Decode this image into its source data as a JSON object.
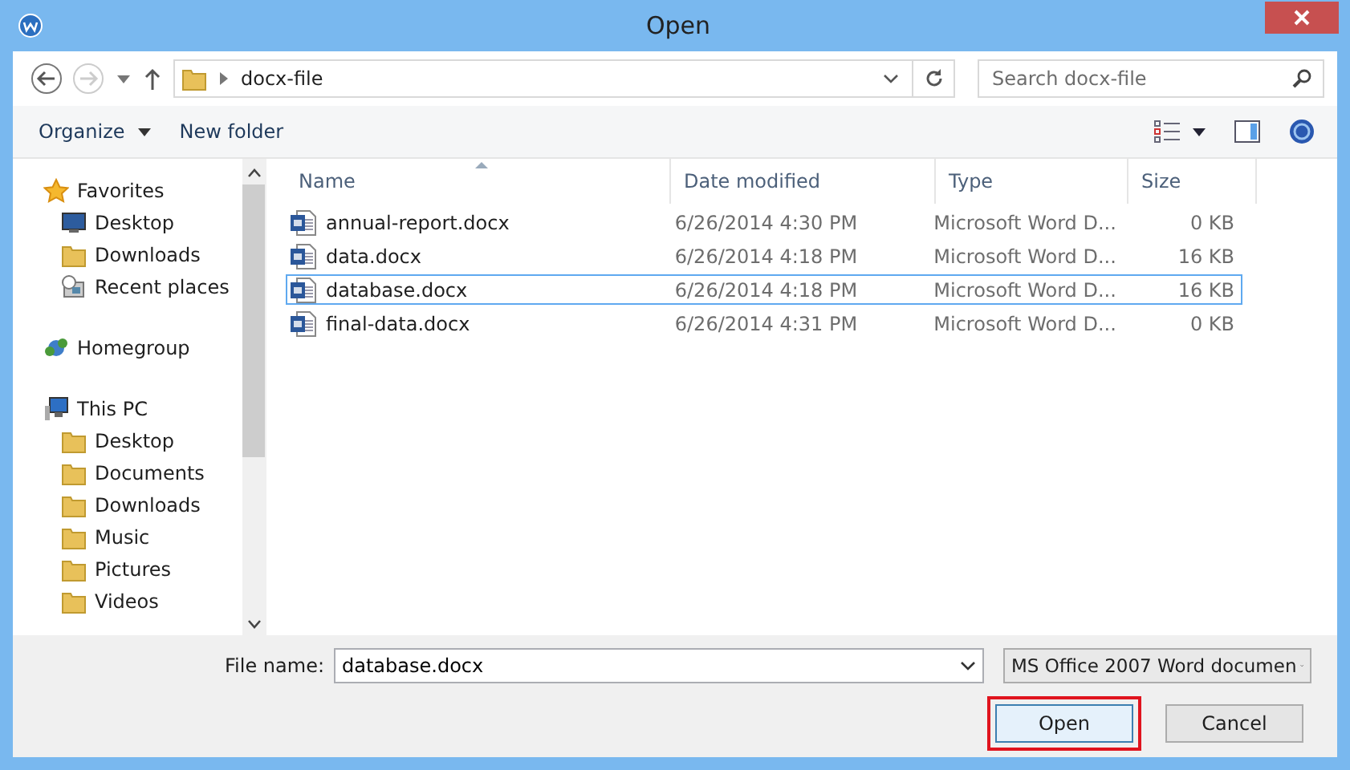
{
  "window": {
    "title": "Open"
  },
  "address": {
    "path": "docx-file"
  },
  "search": {
    "placeholder": "Search docx-file"
  },
  "toolbar": {
    "organize": "Organize",
    "new_folder": "New folder"
  },
  "sidebar": {
    "groups": [
      {
        "label": "Favorites",
        "kind": "star",
        "children": [
          {
            "label": "Desktop",
            "kind": "monitor"
          },
          {
            "label": "Downloads",
            "kind": "folder"
          },
          {
            "label": "Recent places",
            "kind": "recent"
          }
        ]
      },
      {
        "label": "Homegroup",
        "kind": "homegroup"
      },
      {
        "label": "This PC",
        "kind": "pc",
        "children": [
          {
            "label": "Desktop",
            "kind": "folder"
          },
          {
            "label": "Documents",
            "kind": "folder"
          },
          {
            "label": "Downloads",
            "kind": "folder"
          },
          {
            "label": "Music",
            "kind": "folder"
          },
          {
            "label": "Pictures",
            "kind": "folder"
          },
          {
            "label": "Videos",
            "kind": "folder"
          }
        ]
      }
    ]
  },
  "table": {
    "columns": [
      {
        "label": "Name",
        "sorted": true
      },
      {
        "label": "Date modified",
        "sorted": false
      },
      {
        "label": "Type",
        "sorted": false
      },
      {
        "label": "Size",
        "sorted": false
      }
    ],
    "rows": [
      {
        "name": "annual-report.docx",
        "date": "6/26/2014 4:30 PM",
        "type": "Microsoft Word D...",
        "size": "0 KB",
        "selected": false
      },
      {
        "name": "data.docx",
        "date": "6/26/2014 4:18 PM",
        "type": "Microsoft Word D...",
        "size": "16 KB",
        "selected": false
      },
      {
        "name": "database.docx",
        "date": "6/26/2014 4:18 PM",
        "type": "Microsoft Word D...",
        "size": "16 KB",
        "selected": true
      },
      {
        "name": "final-data.docx",
        "date": "6/26/2014 4:31 PM",
        "type": "Microsoft Word D...",
        "size": "0 KB",
        "selected": false
      }
    ]
  },
  "footer": {
    "file_name_label": "File name:",
    "file_name": "database.docx",
    "file_type": "MS Office 2007 Word documen",
    "buttons": [
      {
        "label": "Open",
        "highlighted": true
      },
      {
        "label": "Cancel",
        "highlighted": false
      }
    ]
  }
}
